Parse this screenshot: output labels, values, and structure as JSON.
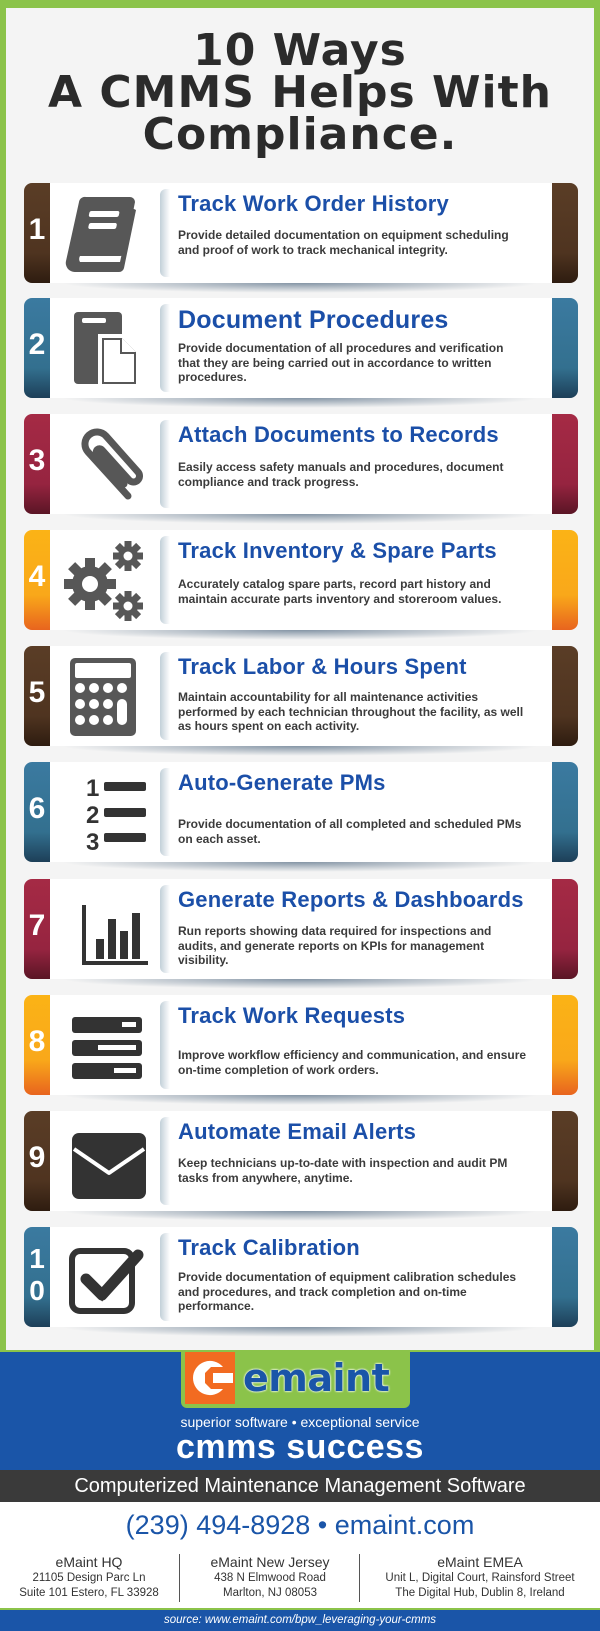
{
  "title": {
    "line1": "10 Ways",
    "line2": "A CMMS Helps With",
    "line3": "Compliance."
  },
  "colors": {
    "brown": "#5a3d26",
    "teal": "#3b7aa0",
    "red": "#a52a45",
    "orange": "#fbb316",
    "heading_blue": "#1b4fa8",
    "frame_green": "#8bc34a",
    "footer_blue": "#1a55a8",
    "logo_orange": "#f26b21"
  },
  "items": [
    {
      "number": "1",
      "icon": "book-icon",
      "title": "Track Work Order History",
      "description": "Provide detailed  documentation on equipment scheduling and proof of work to track mechanical integrity."
    },
    {
      "number": "2",
      "icon": "documents-icon",
      "title": "Document Procedures",
      "description": "Provide documentation of all procedures and verification that they are being carried out in accordance to written procedures."
    },
    {
      "number": "3",
      "icon": "paperclip-icon",
      "title": "Attach Documents to Records",
      "description": "Easily access safety manuals and procedures, document compliance and track progress."
    },
    {
      "number": "4",
      "icon": "gears-icon",
      "title": "Track Inventory & Spare Parts",
      "description": "Accurately catalog spare parts, record part history and maintain accurate parts inventory and storeroom values."
    },
    {
      "number": "5",
      "icon": "calculator-icon",
      "title": "Track Labor & Hours Spent",
      "description": "Maintain accountability for all maintenance activities performed by each technician throughout the facility, as well as hours spent on each activity."
    },
    {
      "number": "6",
      "icon": "numbered-list-icon",
      "title": "Auto-Generate PMs",
      "description": "Provide documentation of all completed and scheduled PMs on each asset."
    },
    {
      "number": "7",
      "icon": "bar-chart-icon",
      "title": "Generate Reports & Dashboards",
      "description": "Run reports showing data required for inspections and audits, and generate reports on KPIs for management visibility."
    },
    {
      "number": "8",
      "icon": "server-list-icon",
      "title": "Track Work Requests",
      "description": "Improve workflow efficiency and communication, and ensure on-time completion of work orders."
    },
    {
      "number": "9",
      "icon": "envelope-icon",
      "title": "Automate Email Alerts",
      "description": "Keep technicians up-to-date with inspection and audit PM tasks from anywhere, anytime."
    },
    {
      "number_top": "1",
      "number_bottom": "0",
      "icon": "checkbox-icon",
      "title": "Track Calibration",
      "description": "Provide documentation of equipment calibration schedules and procedures, and track completion and on-time performance."
    }
  ],
  "footer": {
    "logo_text": "emaint",
    "tagline": "superior software • exceptional service",
    "slogan": "cmms success",
    "product": "Computerized Maintenance Management Software",
    "contact": "(239) 494-8928 • emaint.com",
    "offices": [
      {
        "name": "eMaint HQ",
        "line1": "21105 Design Parc Ln",
        "line2": "Suite 101 Estero, FL 33928"
      },
      {
        "name": "eMaint New Jersey",
        "line1": "438 N Elmwood Road",
        "line2": "Marlton, NJ 08053"
      },
      {
        "name": "eMaint EMEA",
        "line1": "Unit L, Digital Court, Rainsford Street",
        "line2": "The Digital Hub, Dublin 8, Ireland"
      }
    ],
    "source_label": "source:",
    "source_url": "www.emaint.com/bpw_leveraging-your-cmms"
  }
}
